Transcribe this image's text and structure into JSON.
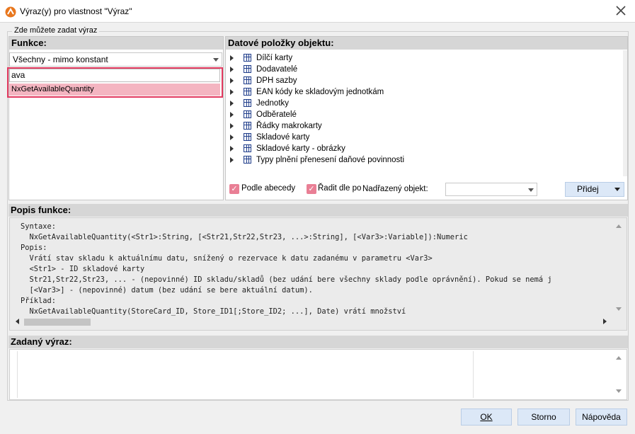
{
  "window": {
    "title": "Výraz(y) pro vlastnost \"Výraz\""
  },
  "group": {
    "legend": "Zde můžete zadat výraz"
  },
  "functions": {
    "header": "Funkce:",
    "filter_value": "Všechny - mimo konstant",
    "search_value": "ava",
    "results": [
      "NxGetAvailableQuantity"
    ]
  },
  "data_items": {
    "header": "Datové položky objektu:",
    "items": [
      "Dílčí karty",
      "Dodavatelé",
      "DPH sazby",
      "EAN kódy ke skladovým jednotkám",
      "Jednotky",
      "Odběratelé",
      "Řádky makrokarty",
      "Skladové karty",
      "Skladové karty - obrázky",
      "Typy plnění přenesení daňové povinnosti"
    ],
    "sort_alpha_label": "Podle abecedy",
    "sort_alpha_checked": true,
    "sort_by_label": "Řadit dle po",
    "sort_by_checked": true,
    "parent_label": "Nadřazený objekt:",
    "parent_value": "",
    "add_button": "Přidej"
  },
  "description": {
    "header": "Popis funkce:",
    "lines": [
      "Syntaxe:",
      "  NxGetAvailableQuantity(<Str1>:String, [<Str21,Str22,Str23, ...>:String], [<Var3>:Variable]):Numeric",
      "Popis:",
      "  Vrátí stav skladu k aktuálnímu datu, snížený o rezervace k datu zadanému v parametru <Var3>",
      "  <Str1> - ID skladové karty",
      "  Str21,Str22,Str23, ... - (nepovinné) ID skladu/skladů (bez udání bere všechny sklady podle oprávnění). Pokud se nemá j",
      "  [<Var3>] - (nepovinné) datum (bez udání se bere aktuální datum).",
      "Příklad:",
      "  NxGetAvailableQuantity(StoreCard_ID, Store_ID1[;Store_ID2; ...], Date) vrátí množství"
    ]
  },
  "expression": {
    "header": "Zadaný výraz:",
    "value": ""
  },
  "buttons": {
    "ok": "OK",
    "cancel": "Storno",
    "help": "Nápověda"
  },
  "colors": {
    "accent_highlight": "#e2395f",
    "selection": "#f4b5c1",
    "checkbox": "#e97f95",
    "button": "#dce8f7",
    "section_header": "#d6d6d6"
  }
}
